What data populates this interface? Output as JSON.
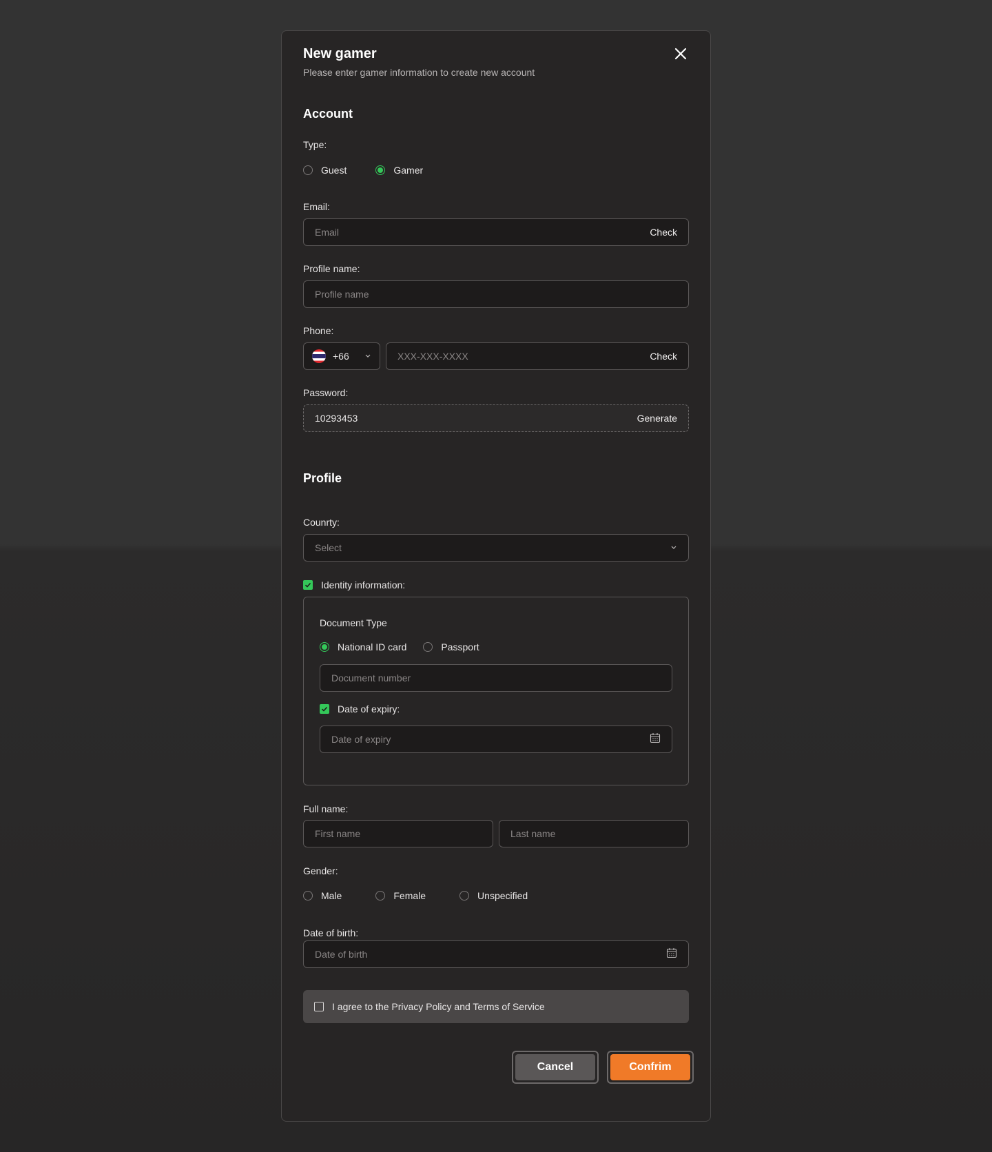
{
  "modal": {
    "title": "New gamer",
    "subtitle": "Please enter gamer information to create new account"
  },
  "account": {
    "heading": "Account",
    "type_label": "Type:",
    "type_options": [
      "Guest",
      "Gamer"
    ],
    "type_selected": "Gamer",
    "email_label": "Email:",
    "email_placeholder": "Email",
    "email_check": "Check",
    "profile_name_label": "Profile name:",
    "profile_name_placeholder": "Profile name",
    "phone_label": "Phone:",
    "phone_code": "+66",
    "phone_placeholder": "XXX-XXX-XXXX",
    "phone_check": "Check",
    "password_label": "Password:",
    "password_value": "10293453",
    "password_generate": "Generate"
  },
  "profile": {
    "heading": "Profile",
    "country_label": "Counrty:",
    "country_placeholder": "Select",
    "identity_label": "Identity information:",
    "document_type_label": "Document Type",
    "document_options": [
      "National ID card",
      "Passport"
    ],
    "document_selected": "National ID card",
    "document_number_placeholder": "Document number",
    "expiry_label": "Date of expiry:",
    "expiry_placeholder": "Date of expiry",
    "fullname_label": "Full name:",
    "first_name_placeholder": "First name",
    "last_name_placeholder": "Last name",
    "gender_label": "Gender:",
    "gender_options": [
      "Male",
      "Female",
      "Unspecified"
    ],
    "dob_label": "Date of birth:",
    "dob_placeholder": "Date of birth",
    "agree_text": "I agree to the Privacy Policy and Terms of Service"
  },
  "actions": {
    "cancel": "Cancel",
    "confirm": "Confrim"
  },
  "colors": {
    "accent_green": "#34c759",
    "confirm_orange": "#f07a28",
    "modal_bg": "#272525"
  }
}
